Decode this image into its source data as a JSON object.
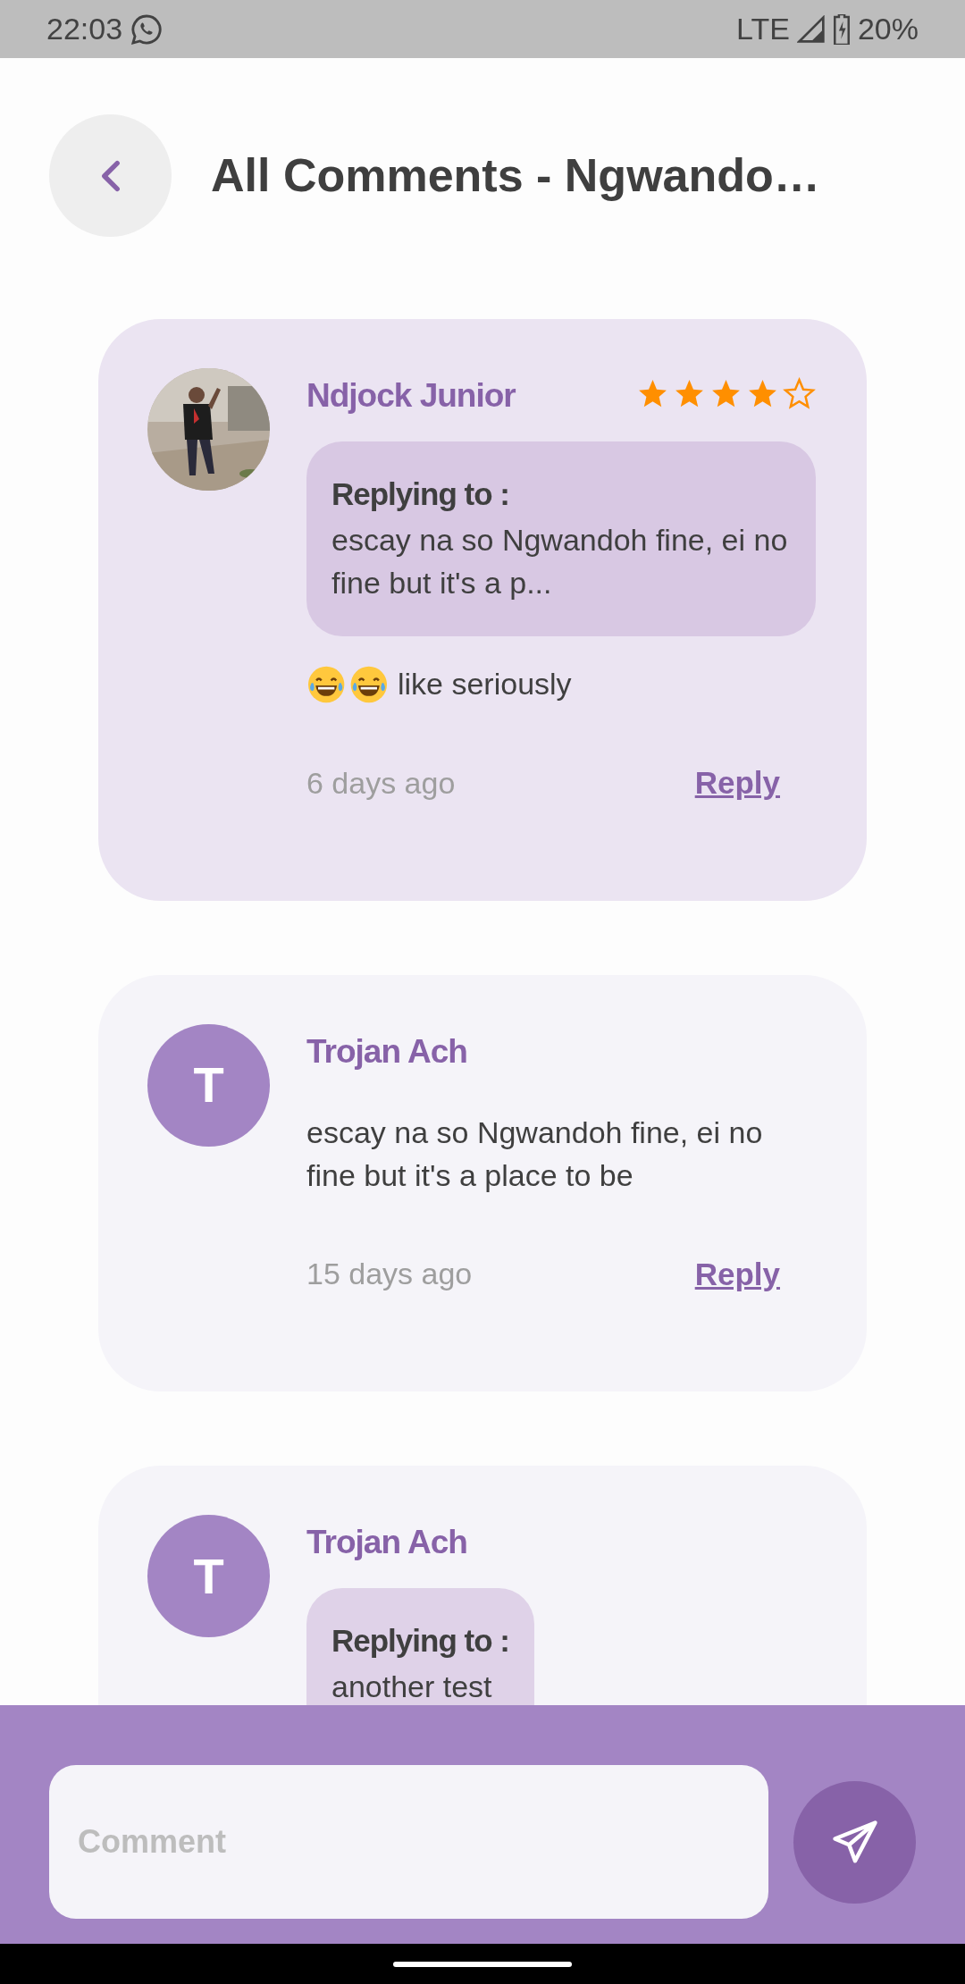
{
  "status_bar": {
    "time": "22:03",
    "network": "LTE",
    "battery": "20%"
  },
  "header": {
    "title": "All Comments - Ngwando…"
  },
  "comments": [
    {
      "author": "Ndjock Junior",
      "stars": 4,
      "replying_to": {
        "label": "Replying to :",
        "text": "escay na so Ngwandoh fine, ei no fine but it's a p..."
      },
      "laughing_emojis": true,
      "text": "like seriously",
      "time": "6 days ago",
      "reply": "Reply",
      "highlighted": true
    },
    {
      "author": "Trojan Ach",
      "avatar": {
        "kind": "initial",
        "letter": "T"
      },
      "text": "escay na so Ngwandoh fine, ei no fine but it's a place to be",
      "time": "15 days ago",
      "reply": "Reply",
      "highlighted": false
    },
    {
      "author": "Trojan Ach",
      "avatar": {
        "kind": "initial",
        "letter": "T"
      },
      "replying_to": {
        "label": "Replying to :",
        "text": "another test"
      },
      "highlighted": false
    }
  ],
  "composer": {
    "placeholder": "Comment"
  }
}
